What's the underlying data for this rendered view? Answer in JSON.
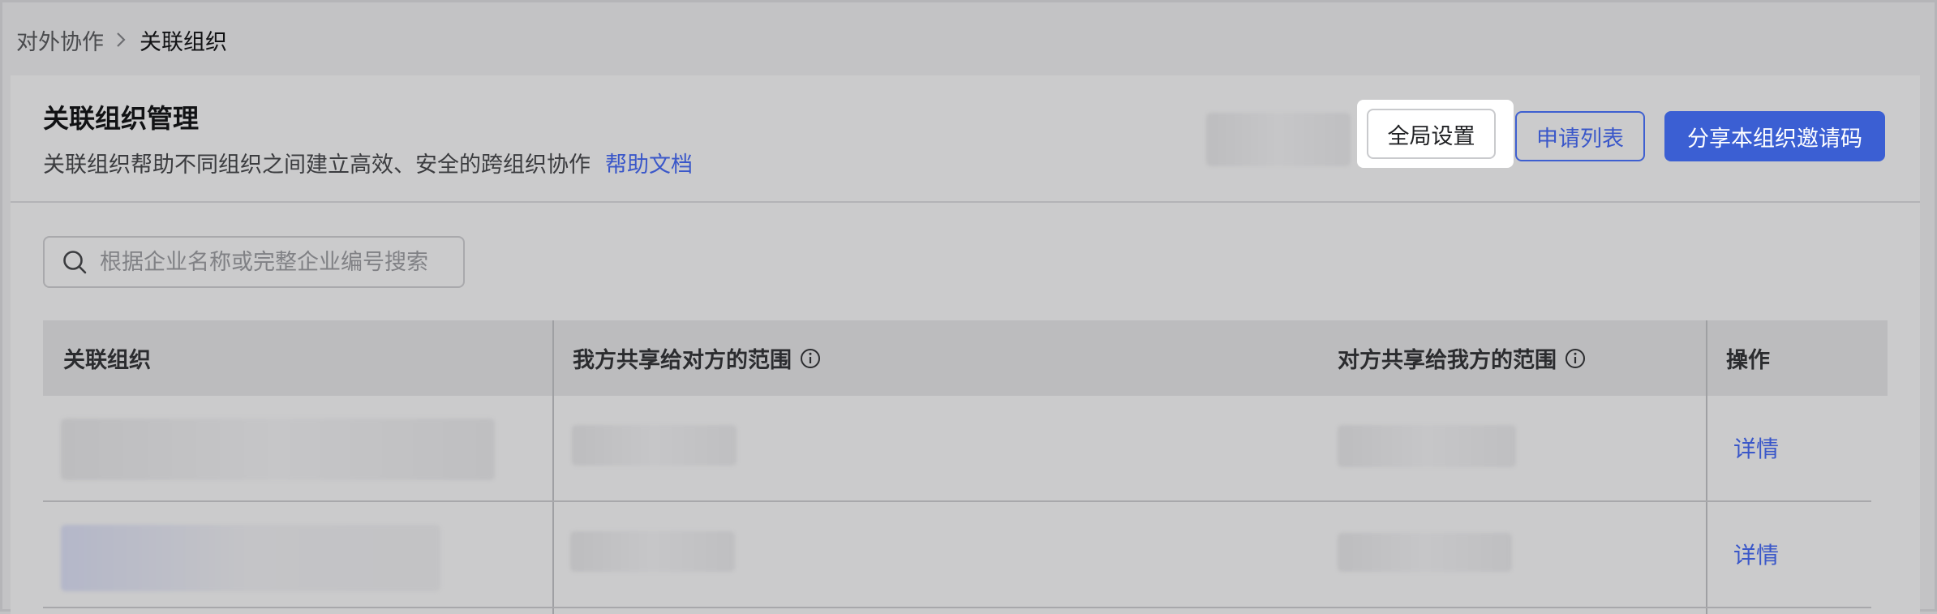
{
  "breadcrumb": {
    "parent": "对外协作",
    "current": "关联组织"
  },
  "header": {
    "title": "关联组织管理",
    "description": "关联组织帮助不同组织之间建立高效、安全的跨组织协作",
    "help_link": "帮助文档"
  },
  "toolbar": {
    "global_settings": "全局设置",
    "apply_list": "申请列表",
    "share_invite_code": "分享本组织邀请码"
  },
  "search": {
    "placeholder": "根据企业名称或完整企业编号搜索",
    "value": ""
  },
  "table": {
    "columns": [
      "关联组织",
      "我方共享给对方的范围",
      "对方共享给我方的范围",
      "操作"
    ],
    "rows": [
      {
        "action": "详情"
      },
      {
        "action": "详情"
      }
    ]
  },
  "colors": {
    "accent": "#3b5fd3",
    "link": "#3a57c9",
    "overlay_background": "#c3c3c5"
  },
  "icons": {
    "breadcrumb_separator": "chevron-right-icon",
    "search": "search-icon",
    "info": "info-icon"
  }
}
